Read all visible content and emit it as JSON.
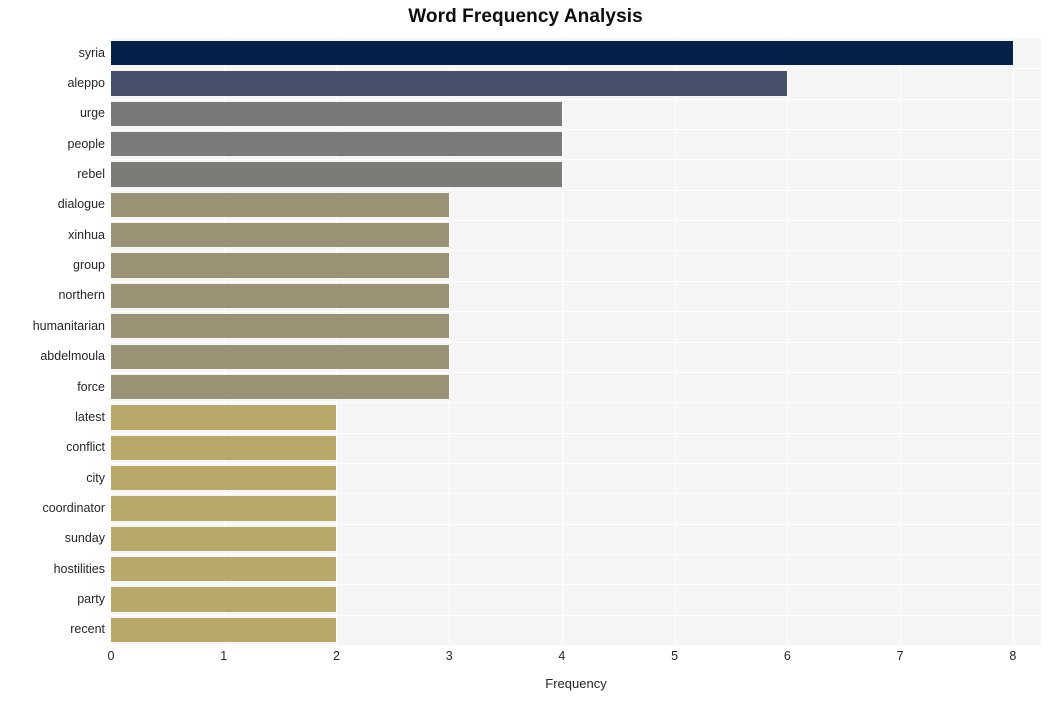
{
  "chart_data": {
    "type": "bar",
    "orientation": "horizontal",
    "title": "Word Frequency Analysis",
    "xlabel": "Frequency",
    "ylabel": "",
    "xlim": [
      0,
      8.25
    ],
    "xticks": [
      "0",
      "1",
      "2",
      "3",
      "4",
      "5",
      "6",
      "7",
      "8"
    ],
    "xtick_values": [
      0,
      1,
      2,
      3,
      4,
      5,
      6,
      7,
      8
    ],
    "grid": true,
    "legend": "none",
    "categories": [
      "syria",
      "aleppo",
      "urge",
      "people",
      "rebel",
      "dialogue",
      "xinhua",
      "group",
      "northern",
      "humanitarian",
      "abdelmoula",
      "force",
      "latest",
      "conflict",
      "city",
      "coordinator",
      "sunday",
      "hostilities",
      "party",
      "recent"
    ],
    "values": [
      8,
      6,
      4,
      4,
      4,
      3,
      3,
      3,
      3,
      3,
      3,
      3,
      2,
      2,
      2,
      2,
      2,
      2,
      2,
      2
    ],
    "bar_colors": [
      "#052049",
      "#47506b",
      "#7b7977",
      "#7c7a78",
      "#7d7b77",
      "#999275",
      "#999275",
      "#999275",
      "#999275",
      "#999275",
      "#999275",
      "#999275",
      "#b9a969",
      "#b9a969",
      "#b9a969",
      "#b9a969",
      "#b9a969",
      "#b9a969",
      "#b9a969",
      "#b9a969"
    ],
    "plot_background": "#f5f5f5",
    "grid_color": "#ffffff",
    "figure_background": "#ffffff",
    "text_color": "#262626"
  }
}
